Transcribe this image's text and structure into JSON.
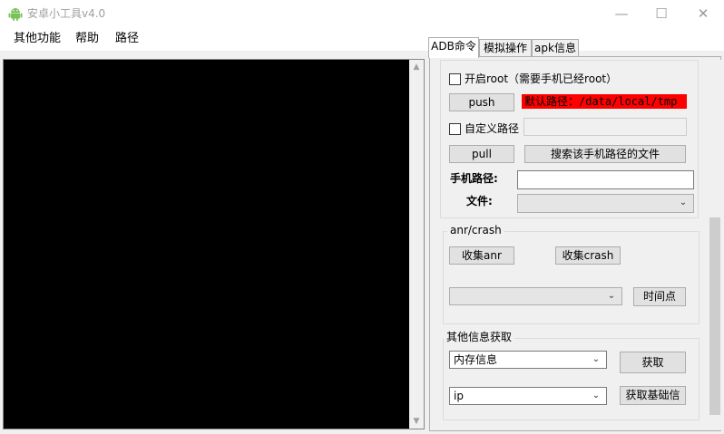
{
  "window": {
    "title": "安卓小工具v4.0",
    "icon": "android-icon",
    "controls": {
      "minimize": "—",
      "maximize": "☐",
      "close": "✕"
    }
  },
  "menu": {
    "items": [
      "其他功能",
      "帮助",
      "路径"
    ]
  },
  "tabs": {
    "items": [
      "ADB命令",
      "模拟操作",
      "apk信息"
    ],
    "active": "ADB命令"
  },
  "adb": {
    "root_checkbox_label": "开启root（需要手机已经root）",
    "push_button": "push",
    "default_path_text": "默认路径：/data/local/tmp",
    "custom_path_label": "自定义路径",
    "pull_button": "pull",
    "search_button": "搜索该手机路径的文件",
    "phone_path_label": "手机路径:",
    "phone_path_value": "",
    "file_label": "文件:",
    "file_value": ""
  },
  "anr": {
    "group_title": "anr/crash",
    "collect_anr_button": "收集anr",
    "collect_crash_button": "收集crash",
    "time_combo_value": "",
    "time_point_button": "时间点"
  },
  "other": {
    "group_title": "其他信息获取",
    "info_combo_value": "内存信息",
    "get_button": "获取",
    "ip_combo_value": "ip",
    "get_basic_button": "获取基础信"
  },
  "colors": {
    "console_bg": "#000000",
    "default_path_bg": "#ff0000",
    "window_bg": "#f0f0f0"
  }
}
